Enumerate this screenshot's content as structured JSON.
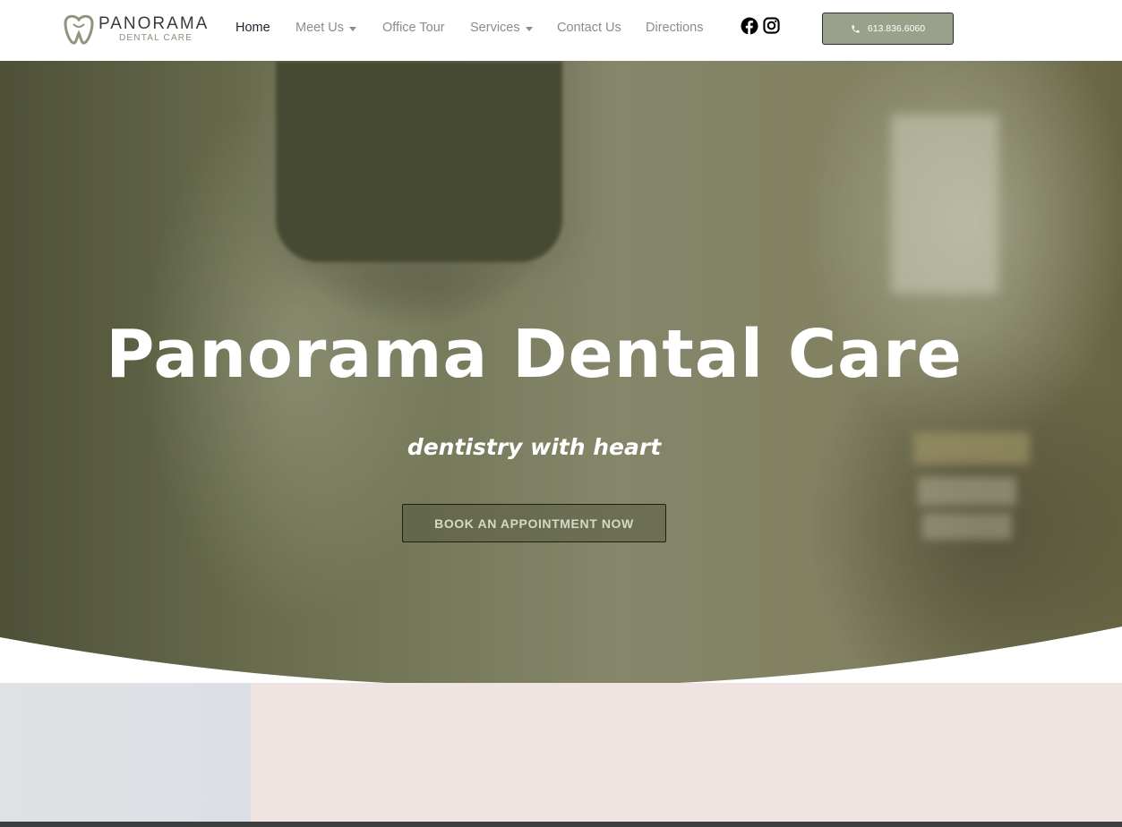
{
  "header": {
    "logo": {
      "brand": "PANORAMA",
      "sub": "DENTAL CARE"
    },
    "nav": [
      {
        "label": "Home",
        "active": true,
        "dropdown": false
      },
      {
        "label": "Meet Us",
        "active": false,
        "dropdown": true
      },
      {
        "label": "Office Tour",
        "active": false,
        "dropdown": false
      },
      {
        "label": "Services",
        "active": false,
        "dropdown": true
      },
      {
        "label": "Contact Us",
        "active": false,
        "dropdown": false
      },
      {
        "label": "Directions",
        "active": false,
        "dropdown": false
      }
    ],
    "social": [
      "facebook-icon",
      "instagram-icon"
    ],
    "phone": {
      "label": "613.836.6060",
      "icon": "phone-icon"
    }
  },
  "hero": {
    "title": "Panorama Dental Care",
    "tagline": "dentistry with heart",
    "cta": "BOOK AN APPOINTMENT NOW"
  },
  "colors": {
    "accent": "#9aa18a",
    "nav_text": "#8c8c8c",
    "nav_active": "#1d2330",
    "section_left": "#dfe1e3",
    "section_right": "#efe4e1"
  }
}
